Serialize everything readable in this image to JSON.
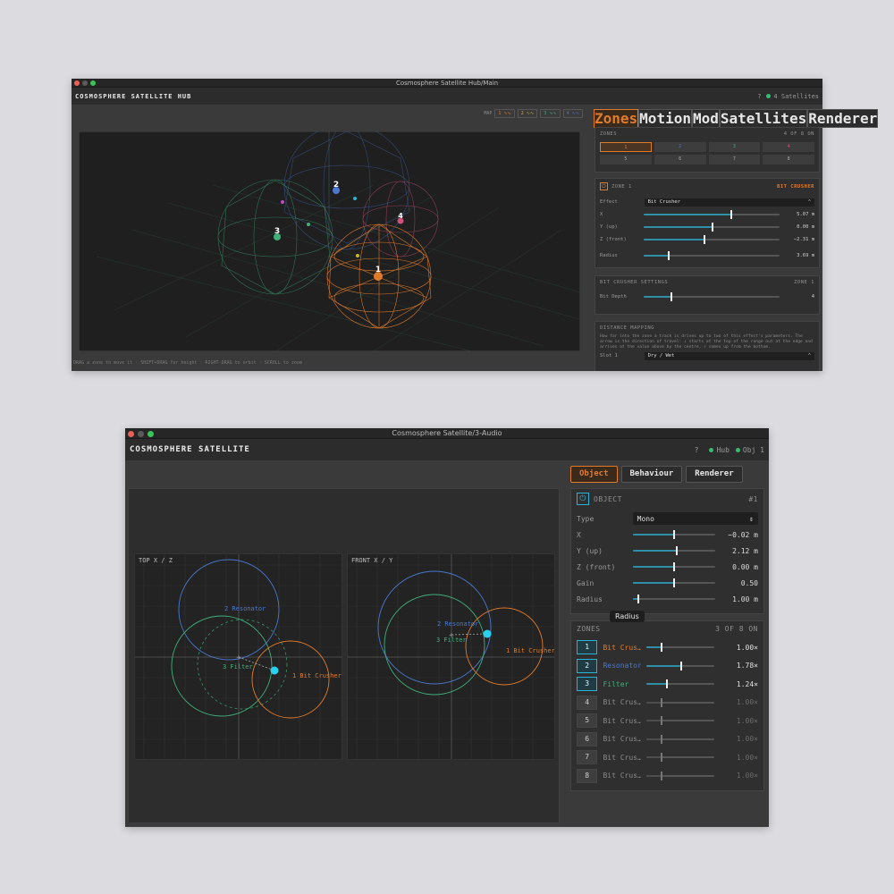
{
  "hub": {
    "window_title": "Cosmosphere Satellite Hub/Main",
    "app_title": "COSMOSPHERE SATELLITE HUB",
    "help": "?",
    "satellites_status": "4 Satellites",
    "map_label": "MAP",
    "map_chips": [
      "1 ∿∿",
      "2 ∿∿",
      "3 ∿∿",
      "4 ∿∿"
    ],
    "tabs": [
      "Zones",
      "Motion",
      "Mod",
      "Satellites",
      "Renderer"
    ],
    "zones_heading": "ZONES",
    "zones_count": "4 OF 8 ON",
    "zone_buttons": [
      "1",
      "2",
      "3",
      "4",
      "5",
      "6",
      "7",
      "8"
    ],
    "zone_header": "ZONE 1",
    "zone_effect_tag": "BIT CRUSHER",
    "effect_label": "Effect",
    "effect_value": "Bit Crusher",
    "params": [
      {
        "label": "X",
        "value": "5.07 m",
        "level": 0.63
      },
      {
        "label": "Y (up)",
        "value": "0.00 m",
        "level": 0.5
      },
      {
        "label": "Z (front)",
        "value": "−2.31 m",
        "level": 0.44
      },
      {
        "label": "Radius",
        "value": "3.69 m",
        "level": 0.18
      }
    ],
    "settings_heading": "BIT CRUSHER SETTINGS",
    "settings_zone": "ZONE 1",
    "bit_depth_label": "Bit Depth",
    "bit_depth_value": "4",
    "bit_depth_level": 0.2,
    "distance_heading": "DISTANCE MAPPING",
    "distance_text": "How far into the zone a track is drives up to two of this effect's parameters. The arrow is the direction of travel: ↓ starts at the top of the range out at the edge and arrives at the value above by the centre, ↑ comes up from the bottom.",
    "slot_label": "Slot 1",
    "slot_value": "Dry / Wet",
    "footer_hint": "DRAG a zone to move it · SHIFT+DRAG for height · RIGHT-DRAG to orbit · SCROLL to zoom",
    "markers": [
      "1",
      "2",
      "3",
      "4"
    ],
    "colors": {
      "accent": "#e07b2a",
      "z1": "#e07b2a",
      "z2": "#4a78d0",
      "z3": "#3fb07a",
      "z4": "#d0507a"
    }
  },
  "sat": {
    "window_title": "Cosmosphere Satellite/3-Audio",
    "app_title": "COSMOSPHERE SATELLITE",
    "help": "?",
    "hub_status": "Hub",
    "obj_status": "Obj 1",
    "tabs": [
      "Object",
      "Behaviour",
      "Renderer"
    ],
    "top_title": "TOP  X / Z",
    "front_title": "FRONT  X / Y",
    "top_labels": [
      "2 Resonator",
      "3 Filter",
      "1 Bit Crusher"
    ],
    "front_labels": [
      "2 Resonator",
      "3 Filter",
      "1 Bit Crusher"
    ],
    "object_heading": "OBJECT",
    "object_number": "#1",
    "type_label": "Type",
    "type_value": "Mono",
    "params": [
      {
        "label": "X",
        "value": "−0.02 m",
        "level": 0.5
      },
      {
        "label": "Y (up)",
        "value": "2.12 m",
        "level": 0.53
      },
      {
        "label": "Z (front)",
        "value": "0.00 m",
        "level": 0.5
      },
      {
        "label": "Gain",
        "value": "0.50",
        "level": 0.5
      },
      {
        "label": "Radius",
        "value": "1.00 m",
        "level": 0.07
      }
    ],
    "tooltip": "Radius",
    "zones_heading": "ZONES",
    "zones_count": "3 OF 8 ON",
    "zones": [
      {
        "n": "1",
        "name": "Bit Crus…",
        "value": "1.00×",
        "on": true,
        "color": "#e07b2a",
        "level": 0.22
      },
      {
        "n": "2",
        "name": "Resonator",
        "value": "1.78×",
        "on": true,
        "color": "#4a78d0",
        "level": 0.5
      },
      {
        "n": "3",
        "name": "Filter",
        "value": "1.24×",
        "on": true,
        "color": "#3fb07a",
        "level": 0.29
      },
      {
        "n": "4",
        "name": "Bit Crus…",
        "value": "1.00×",
        "on": false,
        "color": "#8a8a8a",
        "level": 0.22
      },
      {
        "n": "5",
        "name": "Bit Crus…",
        "value": "1.00×",
        "on": false,
        "color": "#8a8a8a",
        "level": 0.22
      },
      {
        "n": "6",
        "name": "Bit Crus…",
        "value": "1.00×",
        "on": false,
        "color": "#8a8a8a",
        "level": 0.22
      },
      {
        "n": "7",
        "name": "Bit Crus…",
        "value": "1.00×",
        "on": false,
        "color": "#8a8a8a",
        "level": 0.22
      },
      {
        "n": "8",
        "name": "Bit Crus…",
        "value": "1.00×",
        "on": false,
        "color": "#8a8a8a",
        "level": 0.22
      }
    ],
    "colors": {
      "accent": "#e07b2a",
      "cyan": "#2ab3d6",
      "z1": "#e07b2a",
      "z2": "#4a78d0",
      "z3": "#3fb07a"
    }
  }
}
